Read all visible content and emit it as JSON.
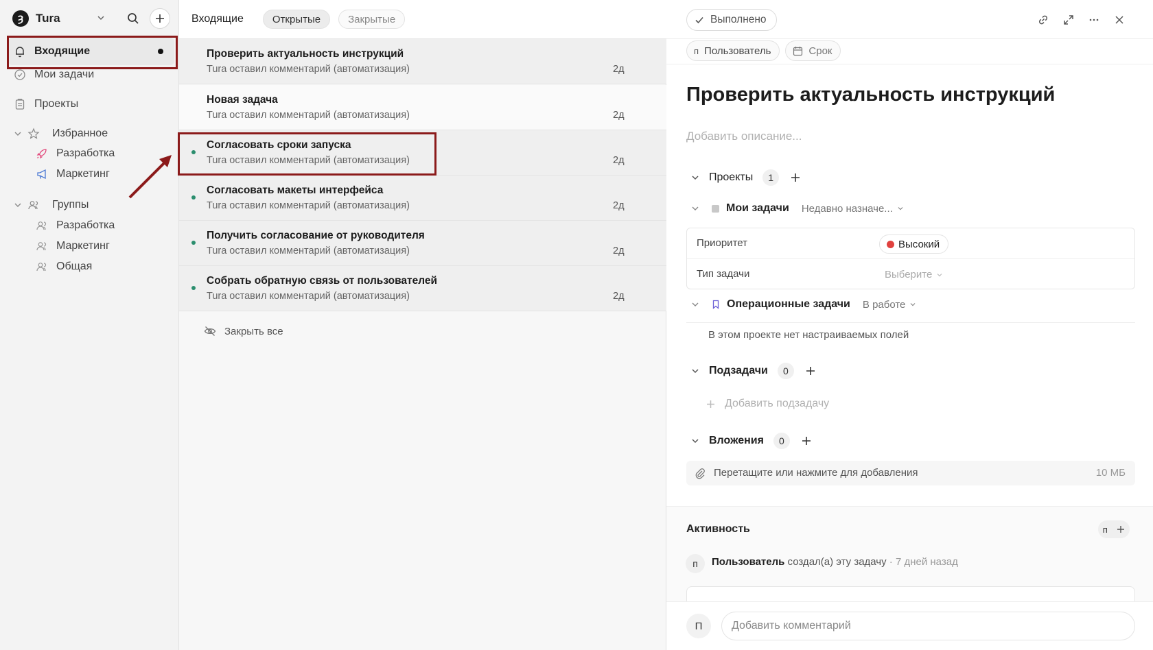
{
  "workspace": {
    "logo": "Ȝ",
    "name": "Tura"
  },
  "sidebar": {
    "inbox": "Входящие",
    "my_tasks": "Мои задачи",
    "projects": "Проекты",
    "favorites": {
      "label": "Избранное",
      "items": [
        "Разработка",
        "Маркетинг"
      ]
    },
    "groups": {
      "label": "Группы",
      "items": [
        "Разработка",
        "Маркетинг",
        "Общая"
      ]
    }
  },
  "list": {
    "title": "Входящие",
    "tabs": [
      "Открытые",
      "Закрытые"
    ],
    "rows": [
      {
        "title": "Проверить актуальность инструкций",
        "sub": "Tura оставил комментарий (автоматизация)",
        "age": "2д",
        "unread": false
      },
      {
        "title": "Новая задача",
        "sub": "Tura оставил комментарий (автоматизация)",
        "age": "2д",
        "unread": false
      },
      {
        "title": "Согласовать сроки запуска",
        "sub": "Tura оставил комментарий (автоматизация)",
        "age": "2д",
        "unread": true
      },
      {
        "title": "Согласовать макеты интерфейса",
        "sub": "Tura оставил комментарий (автоматизация)",
        "age": "2д",
        "unread": true
      },
      {
        "title": "Получить согласование от руководителя",
        "sub": "Tura оставил комментарий (автоматизация)",
        "age": "2д",
        "unread": true
      },
      {
        "title": "Собрать обратную связь от пользователей",
        "sub": "Tura оставил комментарий (автоматизация)",
        "age": "2д",
        "unread": true
      }
    ],
    "close_all": "Закрыть все"
  },
  "detail": {
    "done_label": "Выполнено",
    "assignee_initial": "п",
    "assignee": "Пользователь",
    "due_label": "Срок",
    "title": "Проверить актуальность инструкций",
    "description_placeholder": "Добавить описание...",
    "projects_label": "Проекты",
    "projects_count": "1",
    "project1": {
      "name": "Мои задачи",
      "status": "Недавно назначе..."
    },
    "fields": {
      "priority_label": "Приоритет",
      "priority_value": "Высокий",
      "type_label": "Тип задачи",
      "type_placeholder": "Выберите"
    },
    "project2": {
      "name": "Операционные задачи",
      "status": "В работе"
    },
    "no_fields": "В этом проекте нет настраиваемых полей",
    "subtasks_label": "Подзадачи",
    "subtasks_count": "0",
    "add_subtask": "Добавить подзадачу",
    "attachments_label": "Вложения",
    "attachments_count": "0",
    "drop_text": "Перетащите или нажмите для добавления",
    "drop_limit": "10 МБ",
    "activity_label": "Активность",
    "activity_user_initial": "п",
    "activity_user": "Пользователь",
    "activity_action": "создал(а) эту задачу",
    "activity_time": "· 7 дней назад",
    "composer_initial": "П",
    "comment_placeholder": "Добавить комментарий"
  },
  "colors": {
    "accent_highlight": "#8b1a1a",
    "unread_dot": "#2b8e6e",
    "priority_high": "#e0413e"
  },
  "icons": [
    "bell-icon",
    "check-circle-icon",
    "clipboard-icon",
    "star-icon",
    "rocket-icon",
    "megaphone-icon",
    "users-icon",
    "search-icon",
    "plus-icon",
    "chevron-down-icon",
    "eye-off-icon",
    "check-icon",
    "link-icon",
    "expand-icon",
    "more-icon",
    "close-icon",
    "calendar-icon",
    "bookmark-icon",
    "paperclip-icon"
  ]
}
